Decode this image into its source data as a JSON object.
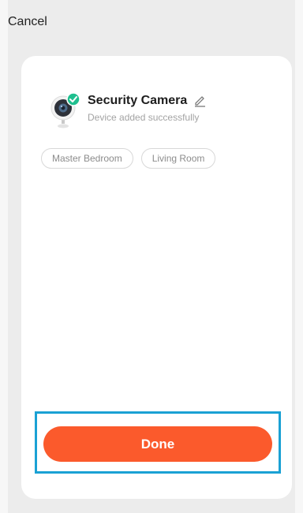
{
  "header": {
    "cancel_label": "Cancel"
  },
  "device": {
    "name": "Security Camera",
    "status": "Device added successfully",
    "icon": "security-camera-icon",
    "badge_icon": "check-badge-icon",
    "edit_icon": "pencil-icon"
  },
  "rooms": [
    {
      "label": "Master Bedroom"
    },
    {
      "label": "Living Room"
    }
  ],
  "actions": {
    "done_label": "Done"
  },
  "colors": {
    "accent": "#fb5a2c",
    "success": "#1fbf8f",
    "highlight": "#1aa1d4"
  }
}
